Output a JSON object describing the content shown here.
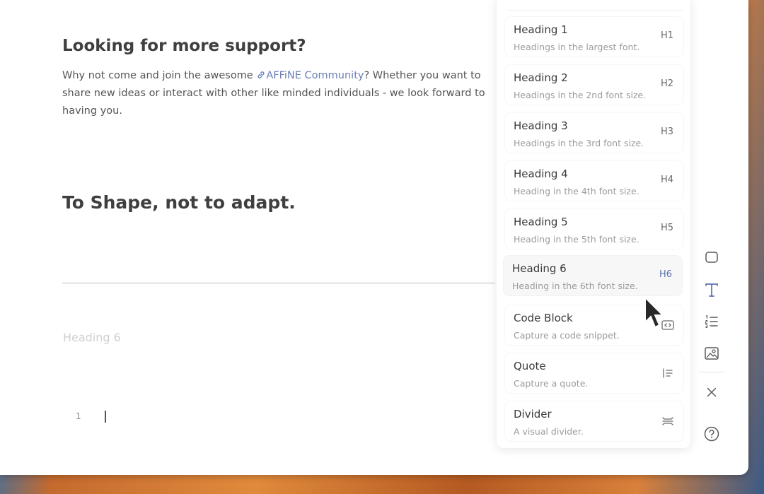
{
  "editor": {
    "support_heading": "Looking for more support?",
    "paragraph": {
      "line1_pre": "Why not come and join the awesome ",
      "link_text": "AFFiNE Community",
      "line1_post": "? Whether you want to",
      "line2": "share new ideas or interact with other like minded individuals - we look forward to",
      "line3": "having you."
    },
    "shape_heading": "To Shape, not to adapt.",
    "placeholder": "Heading 6",
    "line_number": "1"
  },
  "slash_menu": {
    "items": [
      {
        "title": "Heading 1",
        "description": "Headings in the largest font.",
        "shortcut": "H1"
      },
      {
        "title": "Heading 2",
        "description": "Headings in the 2nd font size.",
        "shortcut": "H2"
      },
      {
        "title": "Heading 3",
        "description": "Headings in the 3rd font size.",
        "shortcut": "H3"
      },
      {
        "title": "Heading 4",
        "description": "Heading in the 4th font size.",
        "shortcut": "H4"
      },
      {
        "title": "Heading 5",
        "description": "Heading in the 5th font size.",
        "shortcut": "H5"
      },
      {
        "title": "Heading 6",
        "description": "Heading in the 6th font size.",
        "shortcut": "H6",
        "active": true
      },
      {
        "title": "Code Block",
        "description": "Capture a code snippet.",
        "icon": "code-block-icon"
      },
      {
        "title": "Quote",
        "description": "Capture a quote.",
        "icon": "quote-icon"
      },
      {
        "title": "Divider",
        "description": "A visual divider.",
        "icon": "divider-icon"
      }
    ]
  },
  "toolbar": {
    "tools": [
      "shape-icon",
      "text-icon",
      "list-icon",
      "image-icon",
      "close-icon"
    ],
    "help": "help-icon"
  },
  "colors": {
    "accent": "#5b6fb0",
    "link": "#6b7fb8",
    "text": "#3f3f3f",
    "muted": "#9b9b9b"
  }
}
